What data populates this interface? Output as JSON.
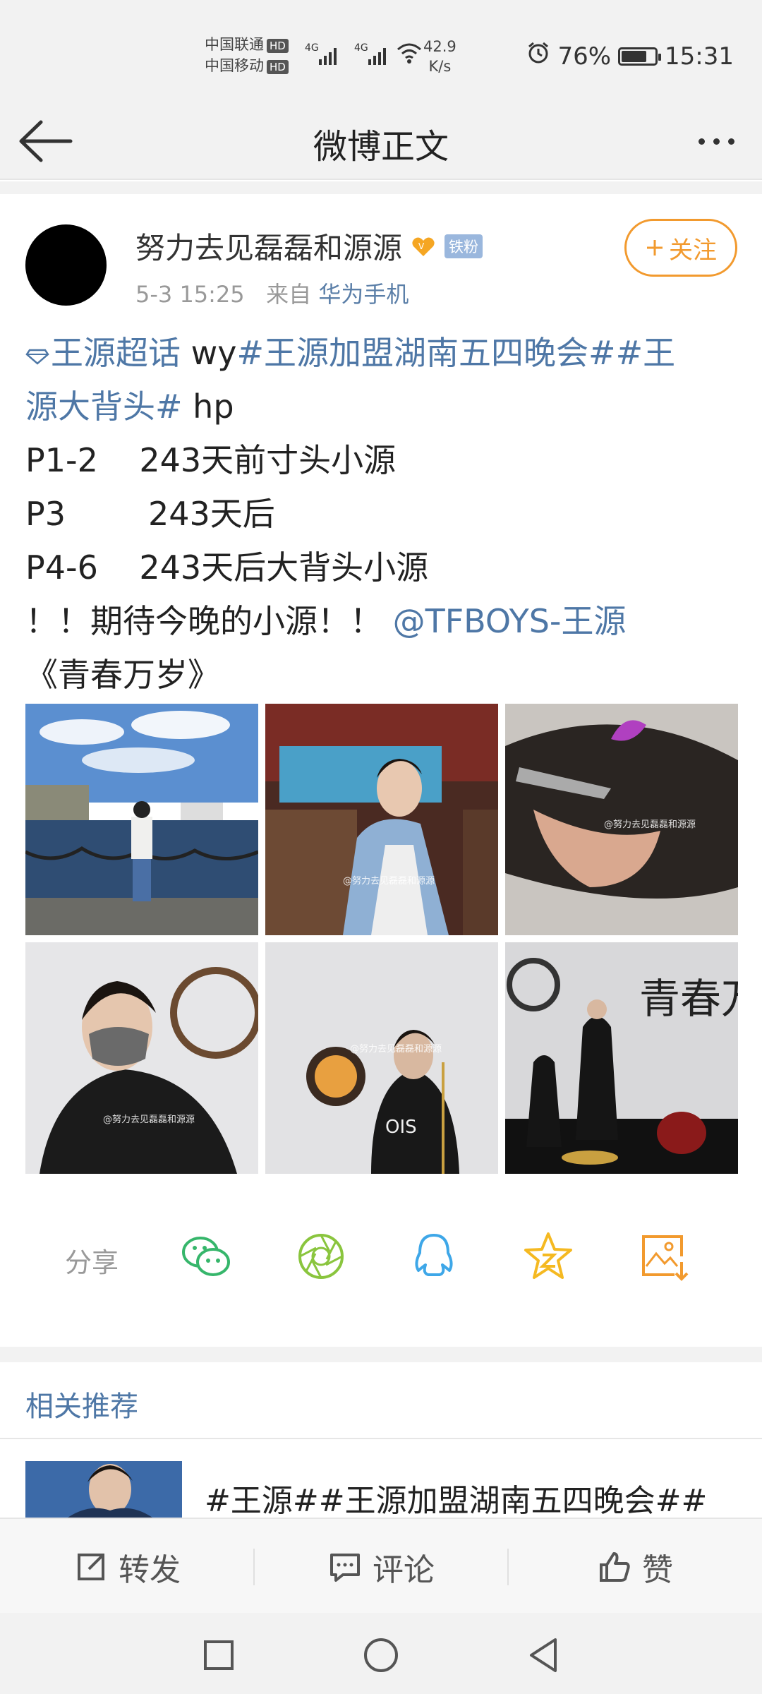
{
  "status_bar": {
    "carrier1": "中国联通",
    "carrier2": "中国移动",
    "hd": "HD",
    "network": "4G",
    "speed_value": "42.9",
    "speed_unit": "K/s",
    "battery": "76%",
    "battery_level": 0.76,
    "time": "15:31"
  },
  "header": {
    "title": "微博正文"
  },
  "post": {
    "username": "努力去见磊磊和源源",
    "fan_badge": "铁粉",
    "date": "5-3 15:25",
    "from_label": "来自",
    "source": "华为手机",
    "follow_label": "关注",
    "text": {
      "super_topic": "王源超话",
      "l1_plain": " wy",
      "tag1": "#王源加盟湖南五四晚会#",
      "tag2a": "#王",
      "tag2b": "源大背头#",
      "l2_plain": " hp",
      "line3": "P1-2    243天前寸头小源",
      "line4": "P3        243天后",
      "line5": "P4-6    243天后大背头小源",
      "line6_plain": "！！期待今晚的小源！！",
      "mention": "@TFBOYS-王源",
      "line7": "《青春万岁》"
    },
    "watermarks": [
      "@努力去见磊磊和源源",
      "@努力去见磊磊和源源",
      "@努力去见磊磊和源源",
      "@努力去见磊磊和源源",
      "@努力去见磊磊和源源"
    ]
  },
  "share": {
    "label": "分享",
    "targets": [
      "wechat-icon",
      "moments-icon",
      "qq-icon",
      "qzone-icon",
      "save-image-icon"
    ]
  },
  "related": {
    "title": "相关推荐",
    "item1_text": "#王源##王源加盟湖南五四晚会##"
  },
  "actions": {
    "repost": "转发",
    "comment": "评论",
    "like": "赞"
  },
  "colors": {
    "link": "#4e77a6",
    "follow": "#f29a2e",
    "fan_badge": "#9ab7dd"
  }
}
